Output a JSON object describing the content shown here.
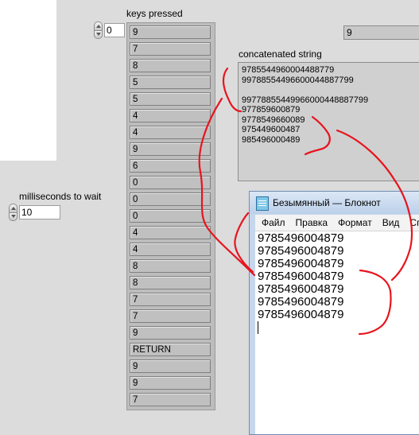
{
  "left_panel": {
    "top_numeric_value": "0",
    "ms_label": "milliseconds to wait",
    "ms_value": "10"
  },
  "keys_pressed": {
    "label": "keys pressed",
    "items": [
      "9",
      "7",
      "8",
      "5",
      "5",
      "4",
      "4",
      "9",
      "6",
      "0",
      "0",
      "0",
      "4",
      "4",
      "8",
      "8",
      "7",
      "7",
      "9",
      "RETURN",
      "9",
      "9",
      "7"
    ]
  },
  "indicator_value": "9",
  "concatenated_string": {
    "label": "concatenated string",
    "lines": [
      "9785544960004488779",
      "99788554496600044887799",
      "",
      "99778855449966000448887799",
      "977859600879",
      "9778549660089",
      "975449600487",
      "985496000489"
    ]
  },
  "notepad": {
    "title": "Безымянный — Блокнот",
    "menu": [
      "Файл",
      "Правка",
      "Формат",
      "Вид",
      "Сп"
    ],
    "lines": [
      "9785496004879",
      "9785496004879",
      "9785496004879",
      "9785496004879",
      "9785496004879",
      "9785496004879",
      "9785496004879"
    ]
  },
  "annotation_color": "#e8141e"
}
